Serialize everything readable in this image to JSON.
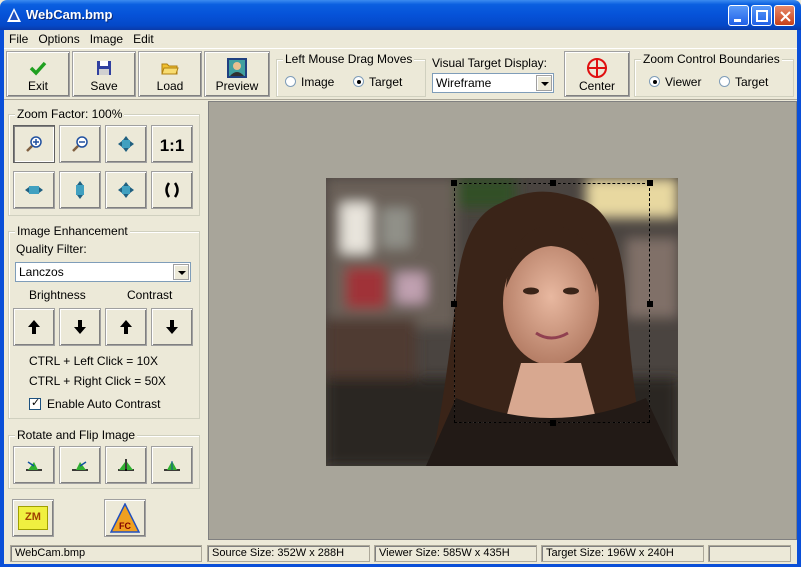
{
  "window": {
    "title": "WebCam.bmp"
  },
  "menu": [
    "File",
    "Options",
    "Image",
    "Edit"
  ],
  "toolbar": {
    "exit": "Exit",
    "save": "Save",
    "load": "Load",
    "preview": "Preview",
    "drag_group": {
      "title": "Left Mouse Drag Moves",
      "opt_image": "Image",
      "opt_target": "Target",
      "selected": "Target"
    },
    "visual_target": {
      "title": "Visual Target Display:",
      "value": "Wireframe"
    },
    "center": "Center",
    "zoom_bounds": {
      "title": "Zoom Control Boundaries",
      "opt_viewer": "Viewer",
      "opt_target": "Target",
      "selected": "Viewer"
    }
  },
  "left": {
    "zoom_title": "Zoom Factor: 100%",
    "one_to_one": "1:1",
    "enh_title": "Image Enhancement",
    "quality_label": "Quality Filter:",
    "quality_value": "Lanczos",
    "brightness": "Brightness",
    "contrast": "Contrast",
    "hint1": "CTRL + Left Click = 10X",
    "hint2": "CTRL + Right Click = 50X",
    "auto_contrast": "Enable Auto Contrast",
    "rotate_title": "Rotate and Flip Image",
    "zm": "ZM",
    "fc": "FC"
  },
  "status": {
    "file": "WebCam.bmp",
    "source": "Source Size: 352W x 288H",
    "viewer": "Viewer Size: 585W x 435H",
    "target": "Target Size: 196W x 240H",
    "extra": ""
  },
  "colors": {
    "title_blue": "#0652d8",
    "viewer_bg": "#a8a59a",
    "accent_red": "#e01010"
  }
}
